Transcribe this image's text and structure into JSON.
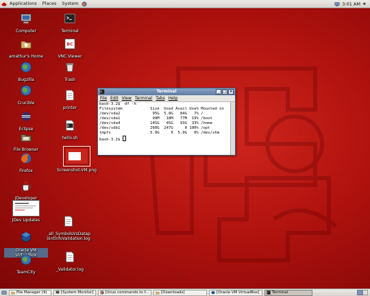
{
  "top_panel": {
    "menus": [
      "Applications",
      "Places",
      "System"
    ],
    "clock": "3:01 AM"
  },
  "desktop_icons": [
    {
      "label": "Computer",
      "icon": "computer-icon"
    },
    {
      "label": "amathur's Home",
      "icon": "home-folder-icon"
    },
    {
      "label": "Bugzilla",
      "icon": "globe-icon"
    },
    {
      "label": "Crucible",
      "icon": "globe-icon"
    },
    {
      "label": "Eclipse",
      "icon": "eclipse-icon"
    },
    {
      "label": "File Browser",
      "icon": "file-browser-icon"
    },
    {
      "label": "Firefox",
      "icon": "firefox-icon"
    },
    {
      "label": "JDeveloper",
      "icon": "jdeveloper-icon"
    },
    {
      "label": "JDev Updates",
      "icon": "document-thumbnail-icon"
    },
    {
      "label": "Oracle VM VirtualBox",
      "icon": "virtualbox-icon"
    },
    {
      "label": "TeamCity",
      "icon": "globe-icon"
    },
    {
      "label": "Terminal",
      "icon": "terminal-icon"
    },
    {
      "label": "VNC Viewer",
      "icon": "vnc-viewer-icon"
    },
    {
      "label": "Trash",
      "icon": "trash-icon"
    },
    {
      "label": "printer",
      "icon": "text-file-icon"
    },
    {
      "label": "hello.sh",
      "icon": "script-file-icon"
    },
    {
      "label": "Screenshot-VM.png",
      "icon": "image-file-icon"
    },
    {
      "label": "_all_SymbolsVsDatapointInfoValidation.log",
      "icon": "text-file-icon"
    },
    {
      "label": "_Validator.log",
      "icon": "text-file-icon"
    }
  ],
  "terminal": {
    "title": "Terminal",
    "menus": [
      "File",
      "Edit",
      "View",
      "Terminal",
      "Tabs",
      "Help"
    ],
    "lines": [
      "bash-3.2$  df -h",
      "Filesystem            Size  Used Avail Use% Mounted on",
      "/dev/sda2              95G  5.8G   84G   7% /",
      "/dev/sda1              99M   18M   77M  19% /boot",
      "/dev/sda4             145G   45G   93G  33% /home",
      "/dev/sdb1             260G  247G     0 100% /opt",
      "tmpfs                 5.9G     0  5.9G   0% /dev/shm"
    ],
    "prompt": "bash-3.2$ "
  },
  "taskbar": [
    {
      "label": "File Manager (9)",
      "icon": "folder-icon",
      "active": false
    },
    {
      "label": "[System Monitor]",
      "icon": "monitor-icon",
      "active": false
    },
    {
      "label": "[linux commands to f...",
      "icon": "firefox-icon",
      "active": false
    },
    {
      "label": "[Downloads]",
      "icon": "folder-icon",
      "active": false
    },
    {
      "label": "[Oracle VM VirtualBox]",
      "icon": "virtualbox-icon",
      "active": false
    },
    {
      "label": "Terminal",
      "icon": "terminal-icon",
      "active": true
    }
  ]
}
